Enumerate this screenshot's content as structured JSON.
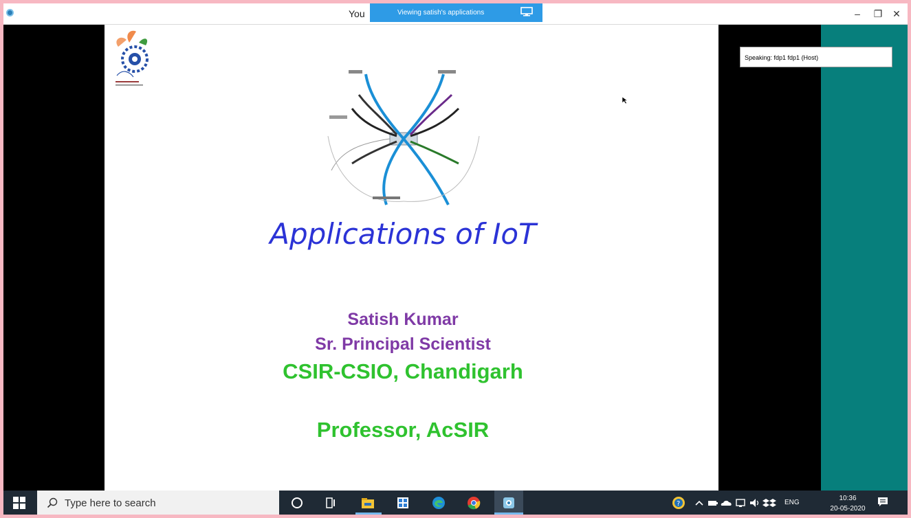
{
  "window": {
    "title": "You",
    "viewing_banner": "Viewing satish's applications",
    "controls": {
      "minimize": "–",
      "restore": "❐",
      "close": "✕"
    }
  },
  "slide": {
    "title": "Applications of IoT",
    "author_name": "Satish Kumar",
    "author_role": "Sr. Principal Scientist",
    "organization": "CSIR-CSIO,  Chandigarh",
    "professor_line": "Professor, AcSIR"
  },
  "speaking_indicator": "Speaking: fdp1 fdp1 (Host)",
  "taskbar": {
    "search_placeholder": "Type here to search",
    "tray_language": "ENG",
    "clock_time": "10:36",
    "clock_date": "20-05-2020"
  },
  "colors": {
    "title_blue": "#2b33d6",
    "author_purple": "#7f3aa6",
    "org_green": "#2fc22f",
    "teal_panel": "#077f7c",
    "banner_blue": "#2e9be6"
  }
}
